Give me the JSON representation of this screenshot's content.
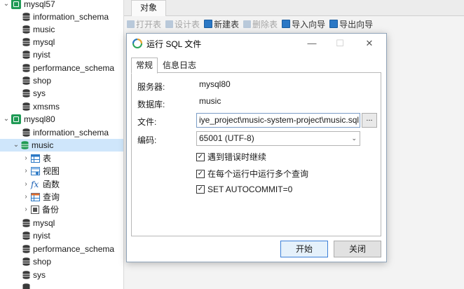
{
  "tree": {
    "items": [
      {
        "label": "mysql57",
        "type": "connection",
        "expanded": true
      },
      {
        "label": "information_schema",
        "type": "database"
      },
      {
        "label": "music",
        "type": "database"
      },
      {
        "label": "mysql",
        "type": "database"
      },
      {
        "label": "nyist",
        "type": "database"
      },
      {
        "label": "performance_schema",
        "type": "database"
      },
      {
        "label": "shop",
        "type": "database"
      },
      {
        "label": "sys",
        "type": "database"
      },
      {
        "label": "xmsms",
        "type": "database"
      },
      {
        "label": "mysql80",
        "type": "connection",
        "expanded": true
      },
      {
        "label": "information_schema",
        "type": "database"
      },
      {
        "label": "music",
        "type": "database",
        "selected": true
      },
      {
        "label": "表",
        "type": "node-table"
      },
      {
        "label": "视图",
        "type": "node-view"
      },
      {
        "label": "函数",
        "type": "node-function"
      },
      {
        "label": "查询",
        "type": "node-query"
      },
      {
        "label": "备份",
        "type": "node-backup"
      },
      {
        "label": "mysql",
        "type": "database"
      },
      {
        "label": "nyist",
        "type": "database"
      },
      {
        "label": "performance_schema",
        "type": "database"
      },
      {
        "label": "shop",
        "type": "database"
      },
      {
        "label": "sys",
        "type": "database"
      }
    ]
  },
  "tab": {
    "label": "对象"
  },
  "toolbar": {
    "open_table": "打开表",
    "design_table": "设计表",
    "new_table": "新建表",
    "delete_table": "删除表",
    "import_wizard": "导入向导",
    "export_wizard": "导出向导"
  },
  "dialog": {
    "title": "运行 SQL 文件",
    "tabs": {
      "general": "常规",
      "log": "信息日志"
    },
    "server_label": "服务器:",
    "server_value": "mysql80",
    "database_label": "数据库:",
    "database_value": "music",
    "file_label": "文件:",
    "file_value": "iye_project\\music-system-project\\music.sql",
    "browse_label": "...",
    "encoding_label": "编码:",
    "encoding_value": "65001 (UTF-8)",
    "options": [
      {
        "label": "遇到错误时继续",
        "checked": true
      },
      {
        "label": "在每个运行中运行多个查询",
        "checked": true
      },
      {
        "label": "SET AUTOCOMMIT=0",
        "checked": true
      }
    ],
    "start_button": "开始",
    "close_button": "关闭"
  },
  "colors": {
    "connection": "#1f9a55",
    "database_icon": "#3a3a3a",
    "selected_row": "#cfe6fb",
    "dialog_border": "#8fa3b8"
  }
}
